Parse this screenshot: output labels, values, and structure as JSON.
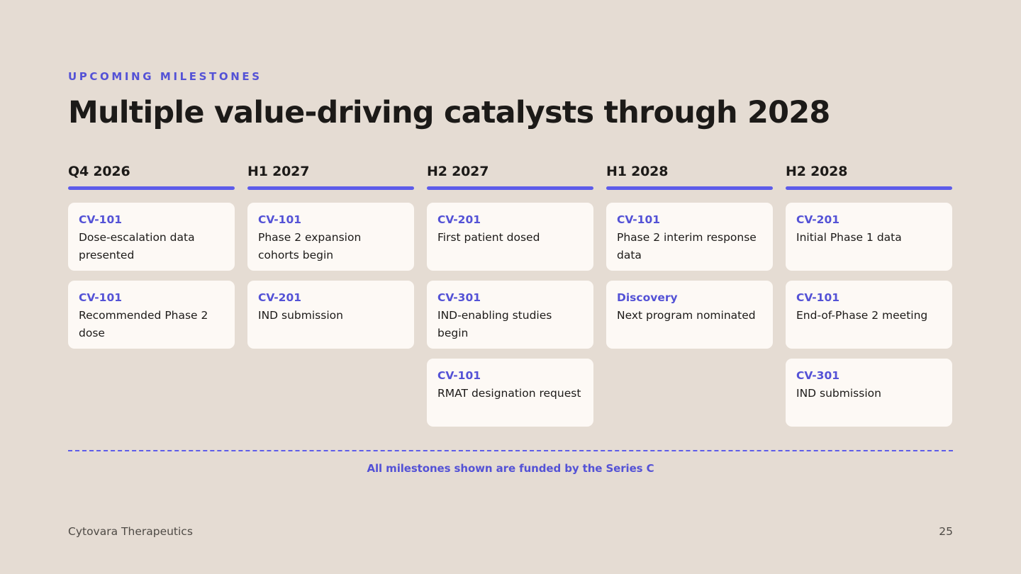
{
  "header": {
    "eyebrow": "UPCOMING MILESTONES",
    "title": "Multiple value-driving catalysts through 2028"
  },
  "colors": {
    "accent": "#5D5CEA",
    "accent_text": "#5452D6",
    "background": "#E5DCD3",
    "card": "#FDF9F5"
  },
  "timeline": [
    {
      "period": "Q4 2026",
      "milestones": [
        {
          "program": "CV-101",
          "text": "Dose-escalation data presented"
        },
        {
          "program": "CV-101",
          "text": "Recommended Phase 2 dose"
        }
      ]
    },
    {
      "period": "H1 2027",
      "milestones": [
        {
          "program": "CV-101",
          "text": "Phase 2 expansion cohorts begin"
        },
        {
          "program": "CV-201",
          "text": "IND submission"
        }
      ]
    },
    {
      "period": "H2 2027",
      "milestones": [
        {
          "program": "CV-201",
          "text": "First patient dosed"
        },
        {
          "program": "CV-301",
          "text": "IND-enabling studies begin"
        },
        {
          "program": "CV-101",
          "text": "RMAT designation request"
        }
      ]
    },
    {
      "period": "H1 2028",
      "milestones": [
        {
          "program": "CV-101",
          "text": "Phase 2 interim response data"
        },
        {
          "program": "Discovery",
          "text": "Next program nominated"
        }
      ]
    },
    {
      "period": "H2 2028",
      "milestones": [
        {
          "program": "CV-201",
          "text": "Initial Phase 1 data"
        },
        {
          "program": "CV-101",
          "text": "End-of-Phase 2 meeting"
        },
        {
          "program": "CV-301",
          "text": "IND submission"
        }
      ]
    }
  ],
  "funding_note": "All milestones shown are funded by the Series C",
  "footer": {
    "company": "Cytovara Therapeutics",
    "page_number": "25"
  }
}
